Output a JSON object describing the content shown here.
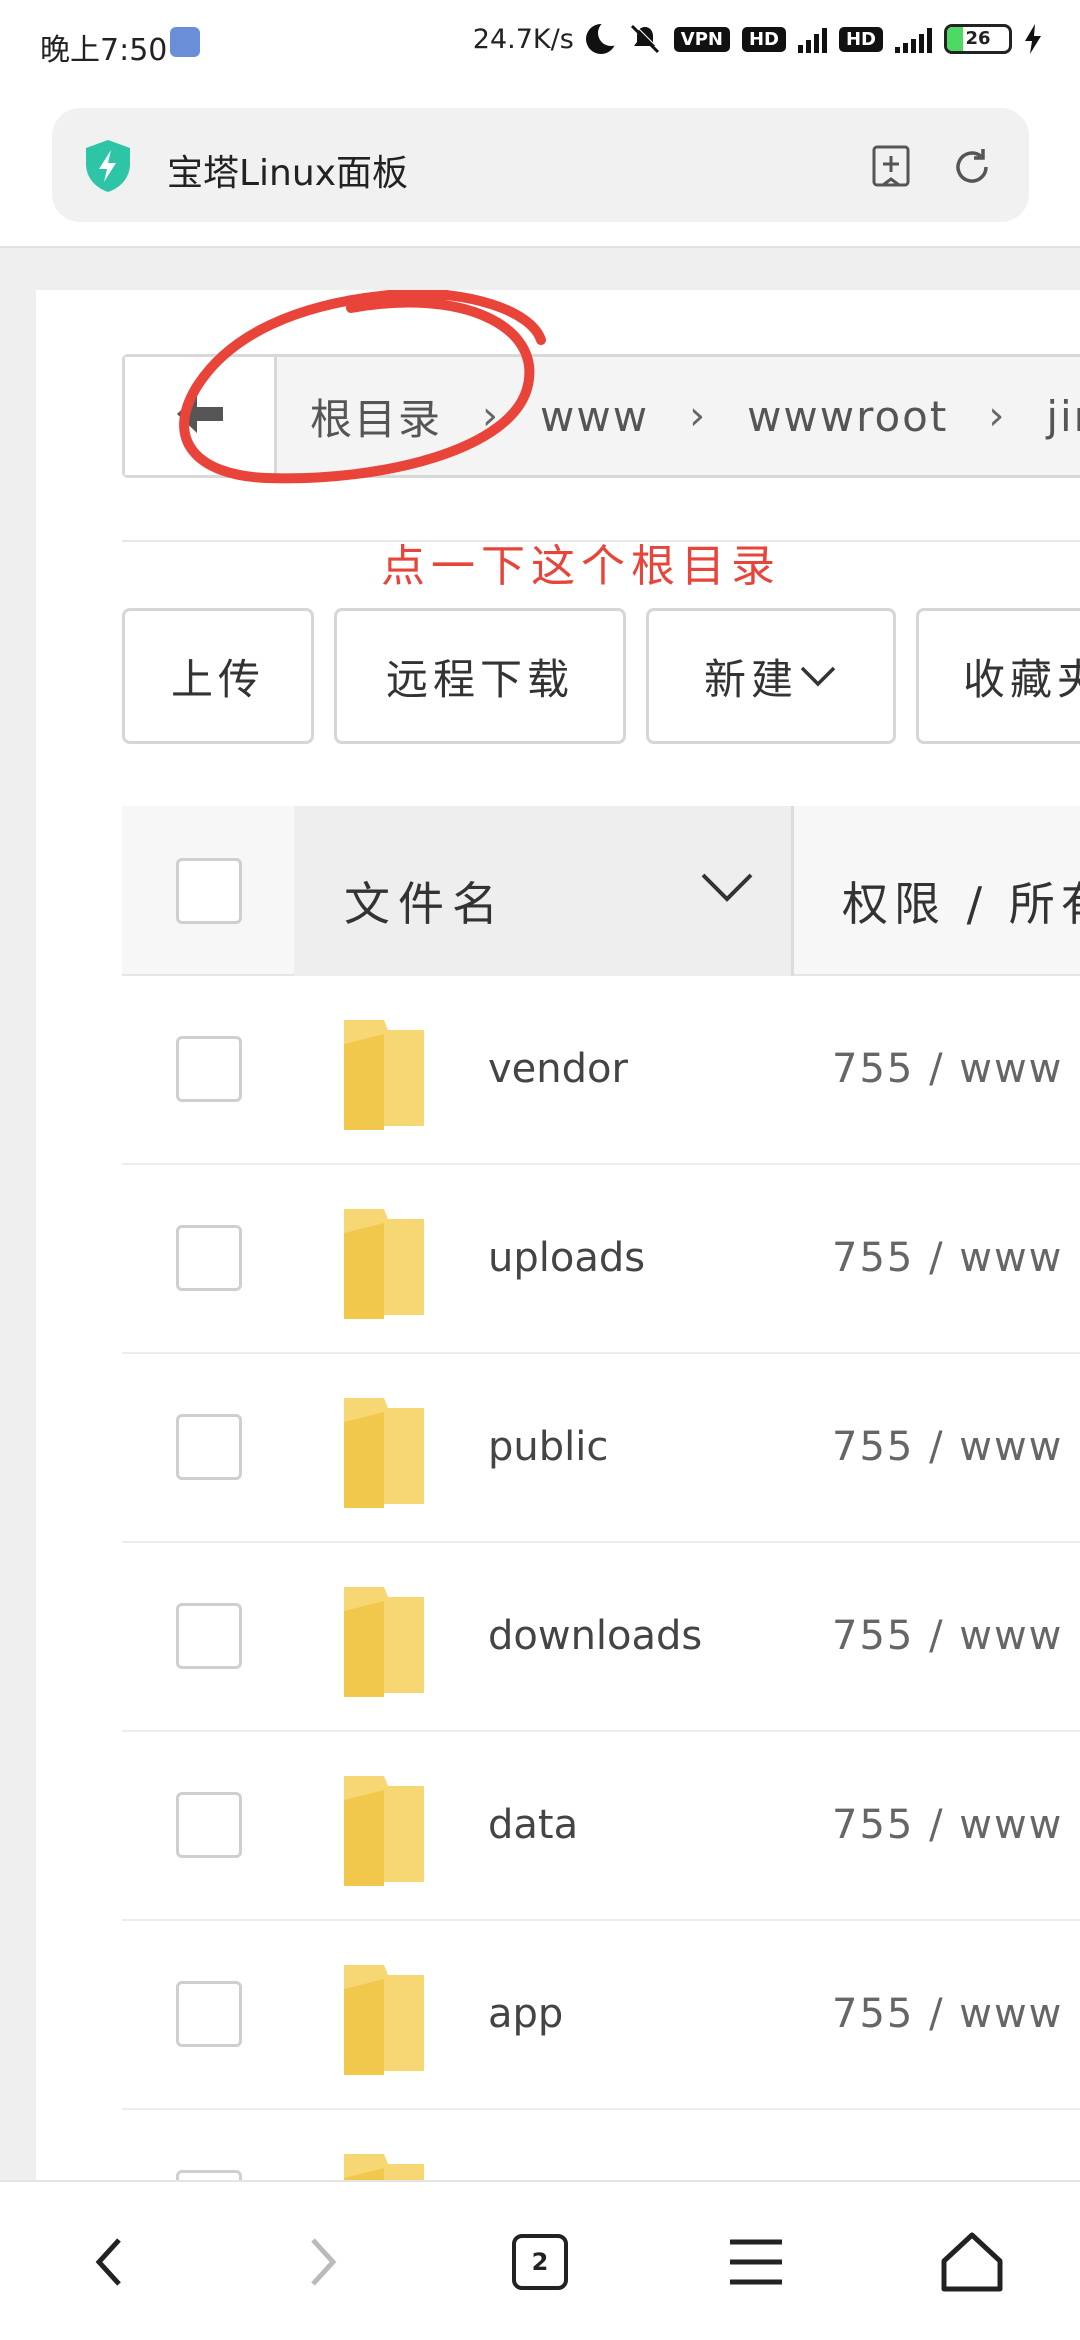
{
  "status_bar": {
    "time": "晚上7:50",
    "net_speed": "24.7K/s",
    "vpn": "VPN",
    "hd1": "HD",
    "hd2": "HD",
    "battery": "26"
  },
  "browser": {
    "title": "宝塔Linux面板",
    "tab_count": "2"
  },
  "breadcrumb": {
    "items": [
      "根目录",
      "www",
      "wwwroot",
      "jin"
    ]
  },
  "annotation": {
    "text": "点一下这个根目录",
    "color": "#e8443a"
  },
  "toolbar": {
    "upload": "上传",
    "remote_download": "远程下载",
    "new": "新建",
    "favorites": "收藏夹"
  },
  "table": {
    "col_name": "文件名",
    "col_perm": "权限 / 所有者",
    "rows": [
      {
        "name": "vendor",
        "perm": "755 / www"
      },
      {
        "name": "uploads",
        "perm": "755 / www"
      },
      {
        "name": "public",
        "perm": "755 / www"
      },
      {
        "name": "downloads",
        "perm": "755 / www"
      },
      {
        "name": "data",
        "perm": "755 / www"
      },
      {
        "name": "app",
        "perm": "755 / www"
      }
    ]
  },
  "colors": {
    "accent_shield": "#2ec4a6",
    "folder": "#f7d774"
  }
}
